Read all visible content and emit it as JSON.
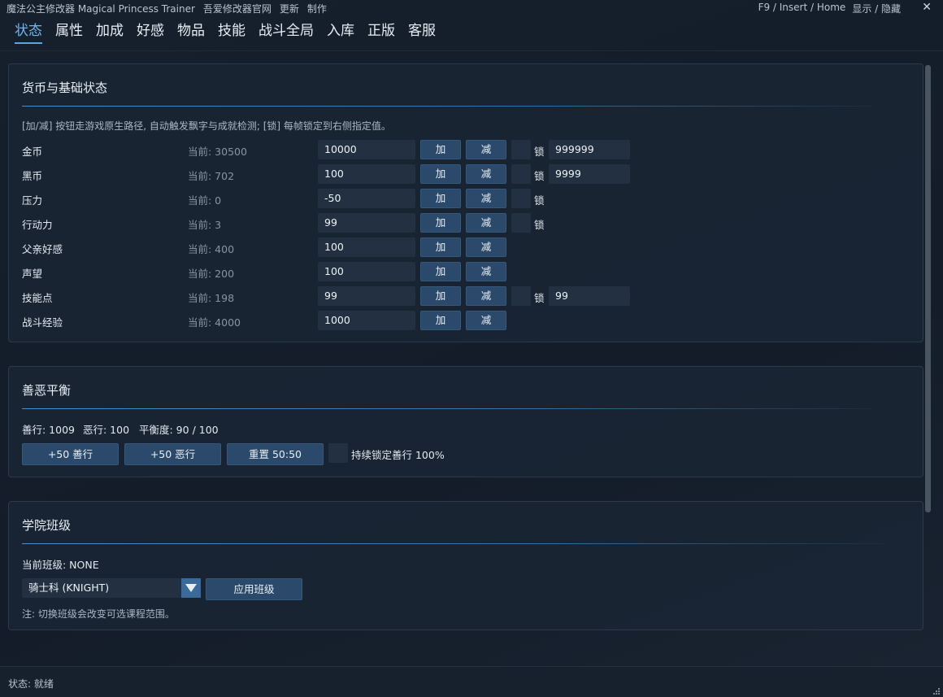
{
  "titlebar": {
    "app_name": "魔法公主修改器 Magical Princess Trainer",
    "menu": [
      "吾爱修改器官网",
      "更新",
      "制作"
    ],
    "hotkey": "F9 / Insert / Home",
    "toggle": "显示 / 隐藏",
    "close": "✕"
  },
  "tabs": [
    "状态",
    "属性",
    "加成",
    "好感",
    "物品",
    "技能",
    "战斗全局",
    "入库",
    "正版",
    "客服"
  ],
  "active_tab": 0,
  "currency": {
    "title": "货币与基础状态",
    "note": "[加/减] 按钮走游戏原生路径, 自动触发飘字与成就检测; [锁] 每帧锁定到右侧指定值。",
    "add_label": "加",
    "sub_label": "减",
    "lock_label": "锁",
    "rows": [
      {
        "label": "金币",
        "current": "当前: 30500",
        "input": "10000",
        "lock": true,
        "lock_value": "999999"
      },
      {
        "label": "黑币",
        "current": "当前: 702",
        "input": "100",
        "lock": true,
        "lock_value": "9999"
      },
      {
        "label": "压力",
        "current": "当前: 0",
        "input": "-50",
        "lock": true,
        "lock_value": ""
      },
      {
        "label": "行动力",
        "current": "当前: 3",
        "input": "99",
        "lock": true,
        "lock_value": ""
      },
      {
        "label": "父亲好感",
        "current": "当前: 400",
        "input": "100",
        "lock": false,
        "lock_value": ""
      },
      {
        "label": "声望",
        "current": "当前: 200",
        "input": "100",
        "lock": false,
        "lock_value": ""
      },
      {
        "label": "技能点",
        "current": "当前: 198",
        "input": "99",
        "lock": true,
        "lock_value": "99"
      },
      {
        "label": "战斗经验",
        "current": "当前: 4000",
        "input": "1000",
        "lock": false,
        "lock_value": ""
      }
    ]
  },
  "karma": {
    "title": "善恶平衡",
    "good": "善行: 1009",
    "evil": "恶行: 100",
    "balance": "平衡度: 90 / 100",
    "btn_good": "+50 善行",
    "btn_evil": "+50 恶行",
    "btn_reset": "重置 50:50",
    "lock_good": "持续锁定善行 100%"
  },
  "academy": {
    "title": "学院班级",
    "current": "当前班级: NONE",
    "selected": "骑士科 (KNIGHT)",
    "apply": "应用班级",
    "note": "注: 切换班级会改变可选课程范围。"
  },
  "status": "状态: 就绪"
}
